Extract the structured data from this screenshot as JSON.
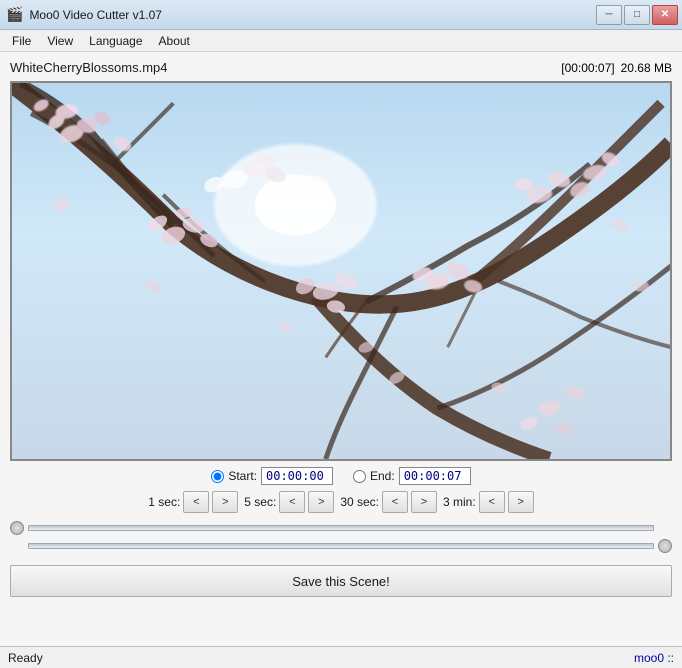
{
  "app": {
    "title": "Moo0 Video Cutter v1.07",
    "icon": "🎬"
  },
  "titlebar": {
    "minimize_label": "─",
    "maximize_label": "□",
    "close_label": "✕"
  },
  "menu": {
    "items": [
      "File",
      "View",
      "Language",
      "About"
    ]
  },
  "file": {
    "name": "WhiteCherryBlossoms.mp4",
    "duration": "[00:00:07]",
    "size": "20.68 MB"
  },
  "controls": {
    "start_label": "Start:",
    "end_label": "End:",
    "start_time": "00:00:00",
    "end_time": "00:00:07"
  },
  "adjustments": [
    {
      "label": "1 sec:",
      "back": "<",
      "forward": ">"
    },
    {
      "label": "5 sec:",
      "back": "<",
      "forward": ">"
    },
    {
      "label": "30 sec:",
      "back": "<",
      "forward": ">"
    },
    {
      "label": "3 min:",
      "back": "<",
      "forward": ">"
    }
  ],
  "save": {
    "label": "Save this Scene!"
  },
  "status": {
    "text": "Ready",
    "link": "moo0 ::"
  }
}
